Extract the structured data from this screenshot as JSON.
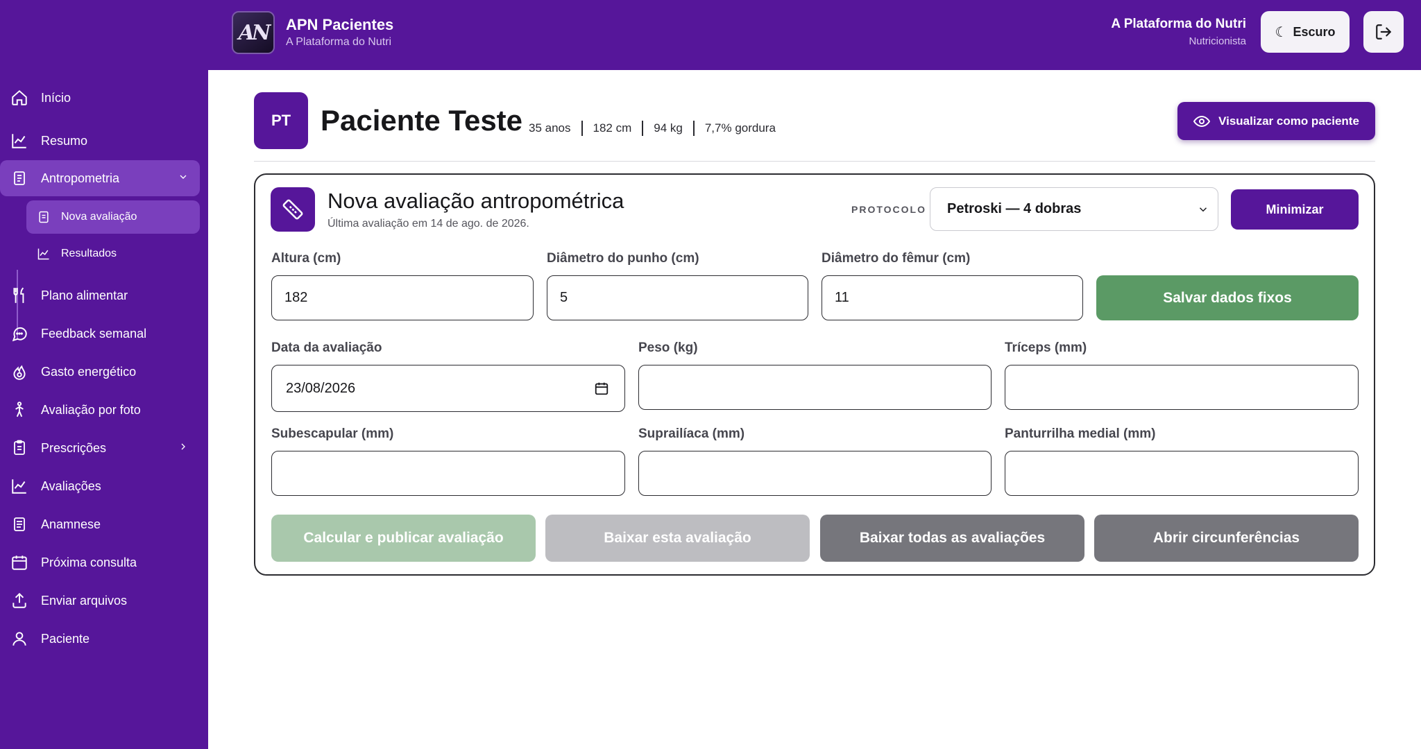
{
  "app": {
    "title": "APN Pacientes",
    "subtitle": "A Plataforma do Nutri",
    "logo_text": "AN"
  },
  "user": {
    "name": "A Plataforma do Nutri",
    "role": "Nutricionista"
  },
  "header_buttons": {
    "theme_label": "Escuro",
    "theme_icon": "moon-icon",
    "logout_icon": "logout-icon"
  },
  "sidebar": {
    "items": [
      {
        "label": "Início",
        "icon": "home-icon"
      },
      {
        "label": "Resumo",
        "icon": "chart-line-icon"
      },
      {
        "label": "Antropometria",
        "icon": "clipboard-icon"
      },
      {
        "label": "Plano alimentar",
        "icon": "fork-knife-icon"
      },
      {
        "label": "Feedback semanal",
        "icon": "chat-bubble-icon"
      },
      {
        "label": "Gasto energético",
        "icon": "flame-icon"
      },
      {
        "label": "Avaliação por foto",
        "icon": "person-walk-icon"
      },
      {
        "label": "Prescrições",
        "icon": "clipboard-list-icon"
      },
      {
        "label": "Avaliações",
        "icon": "chart-line-icon"
      },
      {
        "label": "Anamnese",
        "icon": "document-icon"
      },
      {
        "label": "Próxima consulta",
        "icon": "calendar-icon"
      },
      {
        "label": "Enviar arquivos",
        "icon": "upload-icon"
      },
      {
        "label": "Paciente",
        "icon": "user-icon"
      }
    ],
    "sub_items": [
      {
        "label": "Nova avaliação",
        "icon": "clipboard-icon"
      },
      {
        "label": "Resultados",
        "icon": "chart-line-icon"
      }
    ]
  },
  "patient": {
    "initials": "PT",
    "name": "Paciente Teste",
    "stats": [
      "35 anos",
      "182 cm",
      "94 kg",
      "7,7% gordura"
    ],
    "view_button": "Visualizar como paciente"
  },
  "form": {
    "title": "Nova avaliação antropométrica",
    "subtitle": "Última avaliação em 14 de ago. de 2026.",
    "protocol_label": "PROTOCOLO",
    "protocol_value": "Petroski — 4 dobras",
    "minimize_label": "Minimizar",
    "fixed": {
      "height_label": "Altura (cm)",
      "height_value": "182",
      "wrist_label": "Diâmetro do punho (cm)",
      "wrist_value": "5",
      "femur_label": "Diâmetro do fêmur (cm)",
      "femur_value": "11",
      "save_label": "Salvar dados fixos"
    },
    "date_label": "Data da avaliação",
    "date_value": "23/08/2026",
    "weight_label": "Peso (kg)",
    "weight_value": "",
    "triceps_label": "Tríceps (mm)",
    "triceps_value": "",
    "subscapular_label": "Subescapular (mm)",
    "subscapular_value": "",
    "suprailiac_label": "Suprailíaca (mm)",
    "suprailiac_value": "",
    "calf_label": "Panturrilha medial (mm)",
    "calf_value": "",
    "actions": {
      "calculate": "Calcular e publicar avaliação",
      "download_one": "Baixar esta avaliação",
      "download_all": "Baixar todas as avaliações",
      "open_circumferences": "Abrir circunferências"
    }
  },
  "colors": {
    "brand": "#56169a",
    "brand_light": "#7a3fbd",
    "success": "#5b9a65",
    "success_disabled": "#a9c8ac",
    "gray_disabled": "#bdbdc1",
    "gray": "#76767c"
  }
}
